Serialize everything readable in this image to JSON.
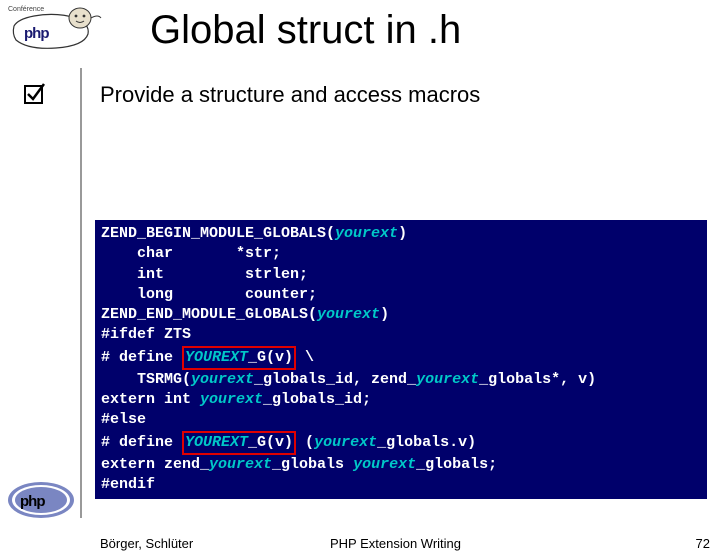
{
  "header": {
    "conference_label": "Conférence",
    "title": "Global struct in .h"
  },
  "bullets": {
    "b1": "Provide a structure and access macros"
  },
  "code": {
    "l1a": "ZEND_BEGIN_MODULE_GLOBALS(",
    "l1b": "yourext",
    "l1c": ")",
    "l2": "    char       *str;",
    "l3": "    int         strlen;",
    "l4": "    long        counter;",
    "l5a": "ZEND_END_MODULE_GLOBALS(",
    "l5b": "yourext",
    "l5c": ")",
    "l6": "#ifdef ZTS",
    "l7a": "# define ",
    "l7b": "YOUREXT",
    "l7c": "_G(v)",
    "l7d": " \\",
    "l8a": "    TSRMG(",
    "l8b": "yourext",
    "l8c": "_globals_id, zend_",
    "l8d": "yourext",
    "l8e": "_globals*, v)",
    "l9a": "extern int ",
    "l9b": "yourext",
    "l9c": "_globals_id;",
    "l10": "#else",
    "l11a": "# define ",
    "l11b": "YOUREXT",
    "l11c": "_G(v)",
    "l11d": " (",
    "l11e": "yourext",
    "l11f": "_globals.v)",
    "l12a": "extern zend_",
    "l12b": "yourext",
    "l12c": "_globals ",
    "l12d": "yourext",
    "l12e": "_globals;",
    "l13": "#endif"
  },
  "footer": {
    "authors": "Börger, Schlüter",
    "center": "PHP Extension Writing",
    "page": "72"
  }
}
